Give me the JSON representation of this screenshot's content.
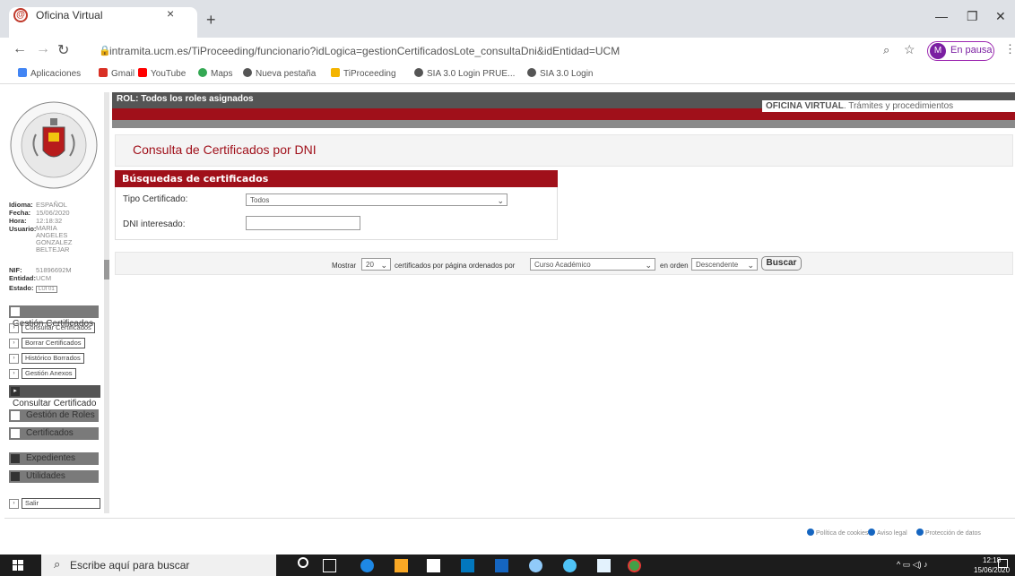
{
  "browser": {
    "tab_title": "Oficina Virtual",
    "tab_close": "×",
    "new_tab": "+",
    "url": "intramita.ucm.es/TiProceeding/funcionario?idLogica=gestionCertificadosLote_consultaDni&idEntidad=UCM",
    "profile_initial": "M",
    "profile_label": "En pausa",
    "bookmarks": [
      "Aplicaciones",
      "Gmail",
      "YouTube",
      "Maps",
      "Nueva pestaña",
      "TiProceeding",
      "SIA 3.0 Login PRUE...",
      "SIA 3.0 Login"
    ]
  },
  "sidebar": {
    "info": [
      {
        "key": "Idioma:",
        "value": "ESPAÑOL"
      },
      {
        "key": "Fecha:",
        "value": "15/06/2020"
      },
      {
        "key": "Hora:",
        "value": "12:18:32"
      },
      {
        "key": "Usuario:",
        "value": "MARIA ANGELES GONZALEZ BELTEJAR"
      },
      {
        "key": "NIF:",
        "value": "51896692M"
      },
      {
        "key": "Entidad:",
        "value": "UCM"
      },
      {
        "key": "Estado:",
        "value": "LUI 01"
      }
    ],
    "menu_section_1": "Gestión Certificados",
    "menu_items": [
      "Consultar Certificados",
      "Borrar Certificados",
      "Histórico Borrados",
      "Gestión Anexos"
    ],
    "menu_active": "Consultar Certificado",
    "menu_sections": [
      "Gestión de Roles",
      "Certificados",
      "Expedientes",
      "Utilidades"
    ],
    "exit": "Salir"
  },
  "header": {
    "rol": "ROL: Todos los roles asignados",
    "ov_bold": "OFICINA VIRTUAL",
    "ov_rest": ". Trámites y procedimientos"
  },
  "page": {
    "title": "Consulta de Certificados por DNI"
  },
  "search": {
    "heading": "Búsquedas de certificados",
    "tipo_label": "Tipo Certificado:",
    "tipo_value": "Todos",
    "dni_label": "DNI interesado:",
    "dni_value": ""
  },
  "pager": {
    "mostrar": "Mostrar",
    "per_page": "20",
    "mid_text": "certificados por página ordenados por",
    "order_by": "Curso Académico",
    "en_orden": "en orden",
    "direction": "Descendente",
    "buscar": "Buscar"
  },
  "footer": {
    "links": [
      "Política de cookies",
      "Aviso legal",
      "Protección de datos"
    ]
  },
  "taskbar": {
    "search_placeholder": "Escribe aquí para buscar",
    "time": "12:18",
    "date": "15/06/2020"
  }
}
